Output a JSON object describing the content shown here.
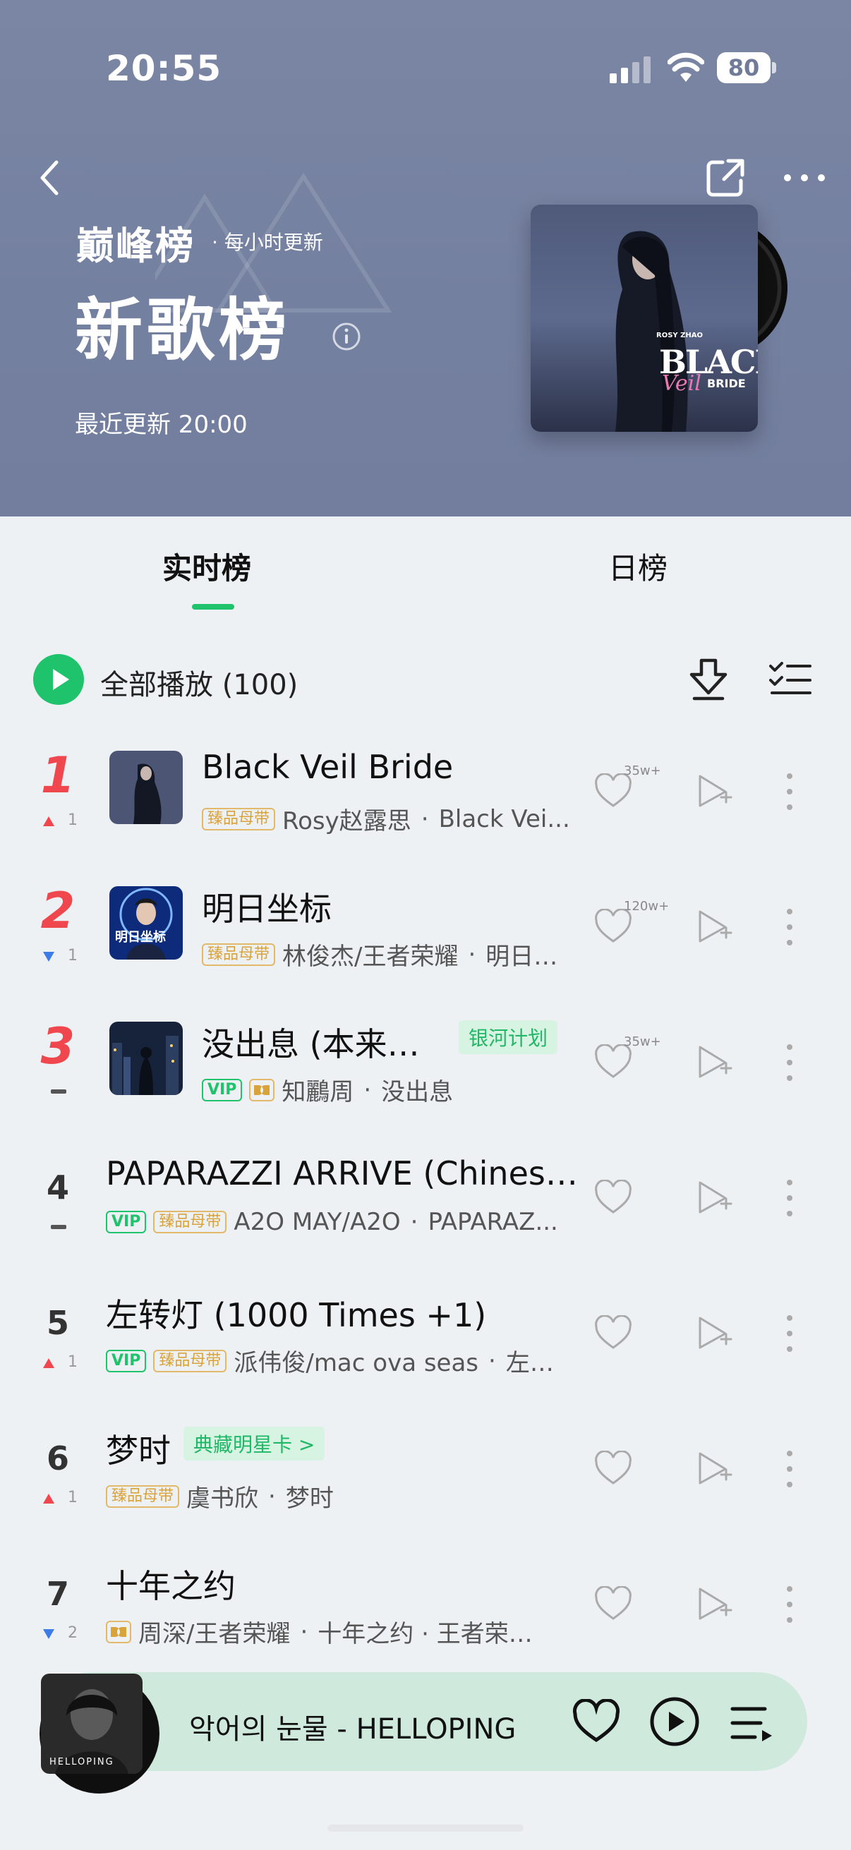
{
  "status_bar": {
    "time": "20:55",
    "battery": "80"
  },
  "header": {
    "brand": "巅峰榜",
    "update_freq": "· 每小时更新",
    "title": "新歌榜",
    "last_updated": "最近更新 20:00",
    "album_text": {
      "artist": "ROSY ZHAO",
      "title1": "BLACK",
      "script": "Veil",
      "title2": "BRIDE"
    }
  },
  "tabs": [
    {
      "label": "实时榜",
      "active": true
    },
    {
      "label": "日榜",
      "active": false
    }
  ],
  "playall": {
    "label": "全部播放 (100)"
  },
  "songs": [
    {
      "rank": "1",
      "trend": "up",
      "change": "1",
      "title": "Black Veil Bride",
      "badges": [
        "臻品母带"
      ],
      "artist": "Rosy赵露思",
      "album": "Black Vei...",
      "likes": "35w+"
    },
    {
      "rank": "2",
      "trend": "down",
      "change": "1",
      "title": "明日坐标",
      "badges": [
        "臻品母带"
      ],
      "artist": "林俊杰/王者荣耀",
      "album": "明日…",
      "likes": "120w+"
    },
    {
      "rank": "3",
      "trend": "same",
      "change": "",
      "title": "没出息 (本来…",
      "tag": "银河计划",
      "badges": [
        "VIP"
      ],
      "artist": "知鸝周",
      "album": "没出息",
      "likes": "35w+"
    },
    {
      "rank": "4",
      "trend": "same",
      "change": "",
      "title": "PAPARAZZI ARRIVE (Chinese...",
      "badges": [
        "VIP",
        "臻品母带"
      ],
      "artist": "A2O MAY/A2O",
      "album": "PAPARAZ...",
      "likes": ""
    },
    {
      "rank": "5",
      "trend": "up",
      "change": "1",
      "title": "左转灯 (1000 Times +1)",
      "badges": [
        "VIP",
        "臻品母带"
      ],
      "artist": "派伟俊/mac ova seas",
      "album": "左…",
      "likes": ""
    },
    {
      "rank": "6",
      "trend": "up",
      "change": "1",
      "title": "梦时",
      "tag": "典藏明星卡 >",
      "badges": [
        "臻品母带"
      ],
      "artist": "虞书欣",
      "album": "梦时",
      "likes": ""
    },
    {
      "rank": "7",
      "trend": "down",
      "change": "2",
      "title": "十年之约",
      "badges": [],
      "artist": "周深/王者荣耀",
      "album": "十年之约 · 王者荣…",
      "likes": ""
    }
  ],
  "thumb_text": {
    "song2": "明日坐标"
  },
  "mini_player": {
    "track": "악어의 눈물 - HELLOPING",
    "cover_text": "HELLOPING"
  },
  "colors": {
    "accent": "#1ec36c",
    "rank_top": "#f0474e",
    "header_bg": "#7480a0"
  }
}
